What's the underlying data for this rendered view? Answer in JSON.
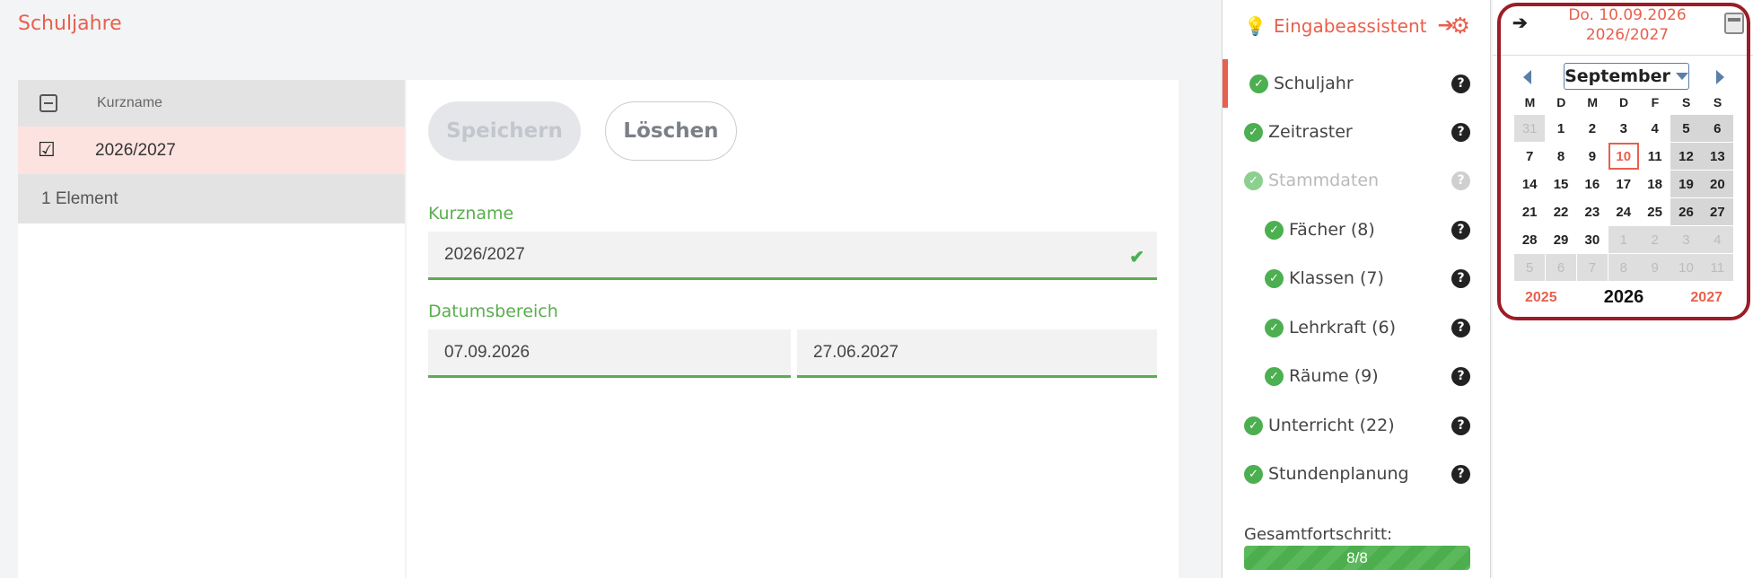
{
  "page": {
    "title": "Schuljahre"
  },
  "list": {
    "header_col": "Kurzname",
    "rows": [
      "2026/2027"
    ],
    "footer": "1 Element"
  },
  "form": {
    "save_label": "Speichern",
    "delete_label": "Löschen",
    "kurzname_label": "Kurzname",
    "kurzname_value": "2026/2027",
    "datumsbereich_label": "Datumsbereich",
    "date_from": "07.09.2026",
    "date_to": "27.06.2027"
  },
  "wizard": {
    "title": "Eingabeassistent",
    "items": [
      {
        "label": "Schuljahr"
      },
      {
        "label": "Zeitraster"
      },
      {
        "label": "Stammdaten"
      },
      {
        "label": "Fächer (8)"
      },
      {
        "label": "Klassen (7)"
      },
      {
        "label": "Lehrkraft (6)"
      },
      {
        "label": "Räume (9)"
      },
      {
        "label": "Unterricht (22)"
      },
      {
        "label": "Stundenplanung"
      }
    ],
    "progress_label": "Gesamtfortschritt:",
    "progress_text": "8/8",
    "progress_fraction": 1.0
  },
  "calendar": {
    "date_line1": "Do. 10.09.2026",
    "date_line2": "2026/2027",
    "month": "September",
    "dow": [
      "M",
      "D",
      "M",
      "D",
      "F",
      "S",
      "S"
    ],
    "weeks": [
      [
        "31",
        "1",
        "2",
        "3",
        "4",
        "5",
        "6"
      ],
      [
        "7",
        "8",
        "9",
        "10",
        "11",
        "12",
        "13"
      ],
      [
        "14",
        "15",
        "16",
        "17",
        "18",
        "19",
        "20"
      ],
      [
        "21",
        "22",
        "23",
        "24",
        "25",
        "26",
        "27"
      ],
      [
        "28",
        "29",
        "30",
        "1",
        "2",
        "3",
        "4"
      ],
      [
        "5",
        "6",
        "7",
        "8",
        "9",
        "10",
        "11"
      ]
    ],
    "year_prev": "2025",
    "year_current": "2026",
    "year_next": "2027",
    "today": "10"
  },
  "colors": {
    "accent": "#e8604c",
    "success": "#5aad4e",
    "highlight_border": "#9c1c27"
  }
}
